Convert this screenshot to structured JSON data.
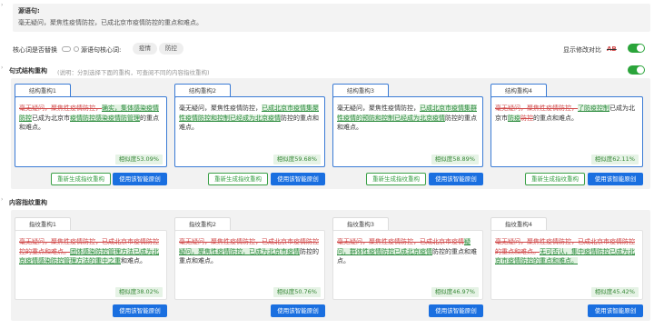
{
  "source": {
    "title": "源语句:",
    "text": "毫无疑问，聚焦性疫情防控，已成北京市疫情防控的重点和难点。"
  },
  "options": {
    "core_replace_label": "核心词是否替换",
    "source_core_label": "源语句核心词:",
    "core_words": [
      "疫情",
      "防控"
    ],
    "show_diff_label": "显示修改对比",
    "diff_tag": "AB",
    "diff_tag_red": "B"
  },
  "structure_section": {
    "title": "句式结构重构",
    "hint": "(说明：分别选择下面的重构，可查阅不同的内容指纹重构)",
    "cards": [
      {
        "tab": "结构重构1",
        "segments": [
          {
            "t": "毫无疑问，聚焦性疫情防控，",
            "c": "del"
          },
          {
            "t": "确实，集体感染疫情防控",
            "c": "add"
          },
          {
            "t": "已成为北京市",
            "c": ""
          },
          {
            "t": "疫情防控感染疫情防管理",
            "c": "add"
          },
          {
            "t": "的重点和难点。",
            "c": ""
          }
        ],
        "similarity": "相似度53.09%",
        "regen": "重新生成指纹重构",
        "use": "使用该智能原创"
      },
      {
        "tab": "结构重构2",
        "segments": [
          {
            "t": "毫无疑问，聚焦性疫情防控，",
            "c": ""
          },
          {
            "t": "已成北京市疫情集",
            "c": "add"
          },
          {
            "t": "聚性疫情防控和控制已经成为北京疫情",
            "c": "add"
          },
          {
            "t": "防控的重点和难点。",
            "c": ""
          }
        ],
        "similarity": "相似度59.68%",
        "regen": "重新生成指纹重构",
        "use": "使用该智能原创"
      },
      {
        "tab": "结构重构3",
        "segments": [
          {
            "t": "毫无疑问，聚焦性疫情防控，",
            "c": ""
          },
          {
            "t": "已成北京市疫情集",
            "c": "add"
          },
          {
            "t": "群性疫情的预防和控制已经成为北京疫情",
            "c": "add"
          },
          {
            "t": "防控的重点和难点。",
            "c": ""
          }
        ],
        "similarity": "相似度58.89%",
        "regen": "重新生成指纹重构",
        "use": "使用该智能原创"
      },
      {
        "tab": "结构重构4",
        "segments": [
          {
            "t": "毫无疑问，聚焦性疫情防控，",
            "c": "del"
          },
          {
            "t": "了防疫控制",
            "c": "add"
          },
          {
            "t": "已成为北京市",
            "c": ""
          },
          {
            "t": "防疫",
            "c": "add"
          },
          {
            "t": "防控",
            "c": "del"
          },
          {
            "t": "的重点和难点。",
            "c": ""
          }
        ],
        "similarity": "相似度62.11%",
        "regen": "重新生成指纹重构",
        "use": "使用该智能原创"
      }
    ]
  },
  "fingerprint_section": {
    "title": "内容指纹重构",
    "cards": [
      {
        "tab": "指纹重构1",
        "segments": [
          {
            "t": "毫无疑问，聚焦性疫情防控，已成北京市疫情防控",
            "c": "del"
          },
          {
            "t": "控的重点和难点。",
            "c": "del"
          },
          {
            "t": "团体感染防控管理方法已成为北京",
            "c": "add"
          },
          {
            "t": "疫情感染防控管理方法的重中之重",
            "c": "add"
          },
          {
            "t": "和难点。",
            "c": ""
          }
        ],
        "similarity": "相似度38.02%",
        "use": "使用该智能原创"
      },
      {
        "tab": "指纹重构2",
        "segments": [
          {
            "t": "毫无疑问，聚焦性疫情防控，",
            "c": "del"
          },
          {
            "t": "已成北京市疫情防控",
            "c": "del"
          },
          {
            "t": "疑问，聚焦性疫情防控，已成为",
            "c": "add"
          },
          {
            "t": "北京市疫情",
            "c": "add"
          },
          {
            "t": "防控的重点和难点。",
            "c": ""
          }
        ],
        "similarity": "相似度50.76%",
        "use": "使用该智能原创"
      },
      {
        "tab": "指纹重构3",
        "segments": [
          {
            "t": "毫无疑问，聚焦性疫情防控，",
            "c": "del"
          },
          {
            "t": "已成北京市疫情",
            "c": "del"
          },
          {
            "t": "疑问，群体性疫情防控已成北京疫情",
            "c": "add"
          },
          {
            "t": "防控的重点和难点。",
            "c": ""
          }
        ],
        "similarity": "相似度46.97%",
        "use": "使用该智能原创"
      },
      {
        "tab": "指纹重构4",
        "segments": [
          {
            "t": "毫无疑问，聚焦性疫情防控，已成北京市疫情",
            "c": "del"
          },
          {
            "t": "防控的重点和难点。",
            "c": "del"
          },
          {
            "t": "无可否认，集中疫情防控已成为北京",
            "c": "add"
          },
          {
            "t": "市疫情防控的重点和难点。",
            "c": "add"
          }
        ],
        "similarity": "相似度45.42%",
        "use": "使用该智能原创"
      }
    ]
  }
}
